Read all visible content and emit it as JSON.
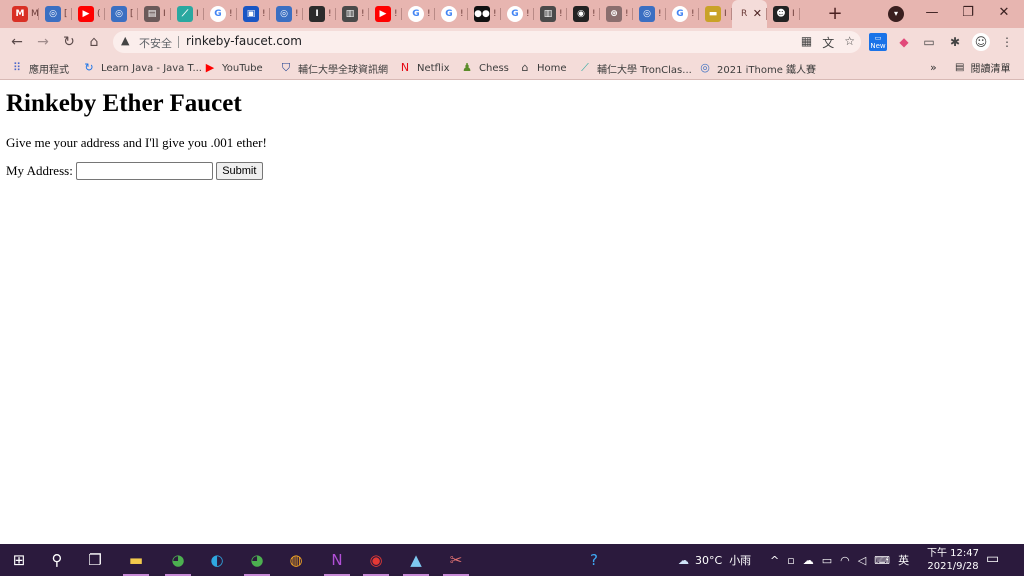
{
  "window": {
    "tabs": [
      {
        "icon": "gmail-icon",
        "glyph": "M",
        "color": "#d93025",
        "label": "M"
      },
      {
        "icon": "site-icon",
        "glyph": "◎",
        "color": "#3b6fc2",
        "label": "["
      },
      {
        "icon": "youtube-icon",
        "glyph": "▶",
        "color": "#ff0000",
        "label": "("
      },
      {
        "icon": "site-icon",
        "glyph": "◎",
        "color": "#3b6fc2",
        "label": "["
      },
      {
        "icon": "document-icon",
        "glyph": "▤",
        "color": "#6b5a5a",
        "label": "I"
      },
      {
        "icon": "tronclass-icon",
        "glyph": "⟋",
        "color": "#2aa8a0",
        "label": "I"
      },
      {
        "icon": "google-icon",
        "glyph": "G",
        "color": "#ffffff",
        "label": "!"
      },
      {
        "icon": "app-icon",
        "glyph": "▣",
        "color": "#1a56c4",
        "label": "!"
      },
      {
        "icon": "site-icon",
        "glyph": "◎",
        "color": "#3b6fc2",
        "label": "!"
      },
      {
        "icon": "ithome-icon",
        "glyph": "I",
        "color": "#2b2b2b",
        "label": "!"
      },
      {
        "icon": "reader-icon",
        "glyph": "▥",
        "color": "#4a4a4a",
        "label": "!"
      },
      {
        "icon": "youtube-icon",
        "glyph": "▶",
        "color": "#ff0000",
        "label": "!"
      },
      {
        "icon": "google-icon",
        "glyph": "G",
        "color": "#ffffff",
        "label": "!"
      },
      {
        "icon": "google-icon",
        "glyph": "G",
        "color": "#ffffff",
        "label": "!"
      },
      {
        "icon": "medium-icon",
        "glyph": "●●",
        "color": "#111111",
        "label": "!"
      },
      {
        "icon": "google-icon",
        "glyph": "G",
        "color": "#ffffff",
        "label": "!"
      },
      {
        "icon": "reader-icon",
        "glyph": "▥",
        "color": "#4a4a4a",
        "label": "!"
      },
      {
        "icon": "github-icon",
        "glyph": "◉",
        "color": "#222222",
        "label": "!"
      },
      {
        "icon": "seal-icon",
        "glyph": "⊛",
        "color": "#8a6e6e",
        "label": "!"
      },
      {
        "icon": "site-icon",
        "glyph": "◎",
        "color": "#3b6fc2",
        "label": "!"
      },
      {
        "icon": "google-icon",
        "glyph": "G",
        "color": "#ffffff",
        "label": "!"
      },
      {
        "icon": "app-icon",
        "glyph": "▬",
        "color": "#c9a227",
        "label": "I"
      },
      {
        "icon": "tab-icon",
        "glyph": "",
        "color": "#f4dcd9",
        "label": "R",
        "active": true
      },
      {
        "icon": "avatar-icon",
        "glyph": "☻",
        "color": "#222222",
        "label": "I"
      }
    ],
    "new_tab": "+",
    "minimize": "—",
    "restore": "❐",
    "close": "✕"
  },
  "toolbar": {
    "not_secure": "不安全",
    "url": "rinkeby-faucet.com"
  },
  "bookmarks": {
    "items": [
      {
        "icon": "apps-grid-icon",
        "glyph": "⠿",
        "label": "應用程式"
      },
      {
        "icon": "java-icon",
        "glyph": "↻",
        "label": "Learn Java - Java T..."
      },
      {
        "icon": "youtube-icon",
        "glyph": "▶",
        "label": "YouTube"
      },
      {
        "icon": "shield-icon",
        "glyph": "⛉",
        "label": "輔仁大學全球資訊網"
      },
      {
        "icon": "netflix-icon",
        "glyph": "N",
        "label": "Netflix"
      },
      {
        "icon": "chess-pawn-icon",
        "glyph": "♟",
        "label": "Chess"
      },
      {
        "icon": "home-icon",
        "glyph": "⌂",
        "label": "Home"
      },
      {
        "icon": "tronclass-icon",
        "glyph": "⟋",
        "label": "輔仁大學 TronClas..."
      },
      {
        "icon": "ithome-icon",
        "glyph": "◎",
        "label": "2021 iThome 鐵人賽"
      }
    ],
    "more": "»",
    "reading_list": "閱讀清單"
  },
  "page": {
    "title": "Rinkeby Ether Faucet",
    "description": "Give me your address and I'll give you .001 ether!",
    "address_label": "My Address:",
    "address_value": "",
    "submit_label": "Submit"
  },
  "taskbar": {
    "weather_temp": "30°C",
    "weather_desc": "小雨",
    "ime": "英",
    "time": "下午 12:47",
    "date": "2021/9/28"
  }
}
